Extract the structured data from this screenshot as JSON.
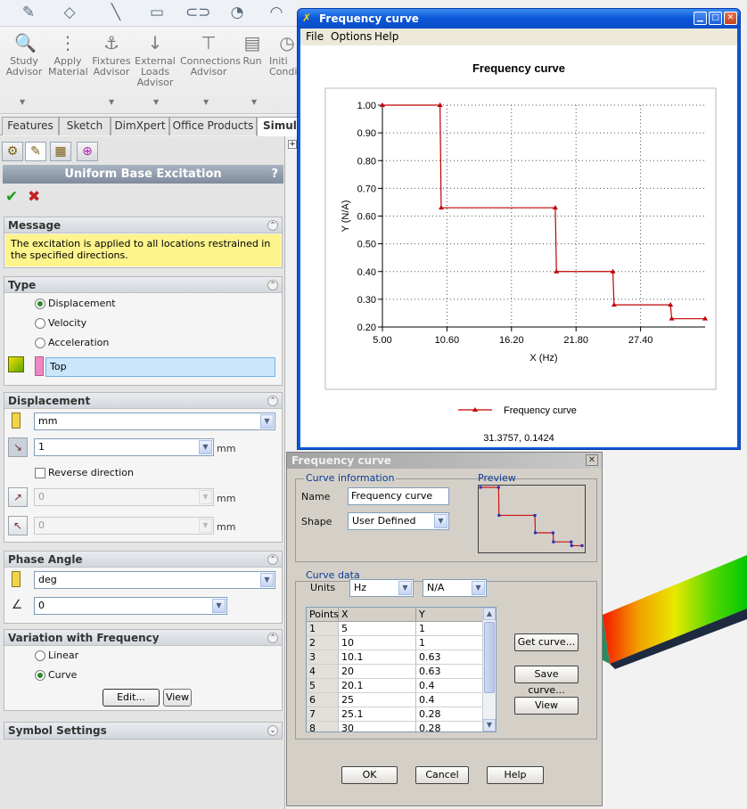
{
  "ribbon": {
    "buttons": [
      {
        "label": "Study\nAdvisor",
        "icon": "study-advisor-icon"
      },
      {
        "label": "Apply\nMaterial",
        "icon": "apply-material-icon"
      },
      {
        "label": "Fixtures\nAdvisor",
        "icon": "fixtures-advisor-icon"
      },
      {
        "label": "External\nLoads\nAdvisor",
        "icon": "external-loads-icon"
      },
      {
        "label": "Connections\nAdvisor",
        "icon": "connections-advisor-icon"
      },
      {
        "label": "Run",
        "icon": "run-icon"
      },
      {
        "label": "Initi\nCondi",
        "icon": "initial-conditions-icon"
      }
    ]
  },
  "tabs": [
    "Features",
    "Sketch",
    "DimXpert",
    "Office Products",
    "Simula"
  ],
  "pm": {
    "title": "Uniform Base Excitation",
    "help": "?",
    "message": {
      "title": "Message",
      "text": "The excitation is applied to all locations restrained in the specified directions."
    },
    "type": {
      "title": "Type",
      "options": [
        "Displacement",
        "Velocity",
        "Acceleration"
      ],
      "selected": "Displacement",
      "direction_reference": "Top"
    },
    "displacement": {
      "title": "Displacement",
      "unit": "mm",
      "value1": "1",
      "value1_unit": "mm",
      "reverse_label": "Reverse direction",
      "value2": "0",
      "value2_unit": "mm",
      "value3": "0",
      "value3_unit": "mm"
    },
    "phase": {
      "title": "Phase Angle",
      "unit": "deg",
      "value": "0"
    },
    "variation": {
      "title": "Variation with Frequency",
      "options": [
        "Linear",
        "Curve"
      ],
      "selected": "Curve",
      "edit_label": "Edit...",
      "view_label": "View"
    },
    "symbol": {
      "title": "Symbol Settings"
    }
  },
  "chart_window": {
    "title": "Frequency curve",
    "menu": [
      "File",
      "Options",
      "Help"
    ],
    "cursor_readout": "31.3757, 0.1424"
  },
  "chart_data": {
    "type": "line",
    "title": "Frequency curve",
    "xlabel": "X (Hz)",
    "ylabel": "Y (N/A)",
    "x_ticks": [
      "5.00",
      "10.60",
      "16.20",
      "21.80",
      "27.40"
    ],
    "y_ticks": [
      "0.20",
      "0.30",
      "0.40",
      "0.50",
      "0.60",
      "0.70",
      "0.80",
      "0.90",
      "1.00"
    ],
    "xlim": [
      5,
      33
    ],
    "ylim": [
      0.2,
      1.0
    ],
    "grid": true,
    "legend": "bottom",
    "series": [
      {
        "name": "Frequency curve",
        "color": "#c00000",
        "x": [
          5,
          10,
          10.1,
          20,
          20.1,
          25,
          25.1,
          30,
          30.1,
          33
        ],
        "y": [
          1,
          1,
          0.63,
          0.63,
          0.4,
          0.4,
          0.28,
          0.28,
          0.23,
          0.23
        ]
      }
    ]
  },
  "curve_dialog": {
    "title": "Frequency curve",
    "info_title": "Curve information",
    "name_label": "Name",
    "name_value": "Frequency curve",
    "shape_label": "Shape",
    "shape_value": "User Defined",
    "preview_title": "Preview",
    "data_title": "Curve data",
    "units_label": "Units",
    "x_unit": "Hz",
    "y_unit": "N/A",
    "columns": [
      "Points",
      "X",
      "Y"
    ],
    "rows": [
      [
        "1",
        "5",
        "1"
      ],
      [
        "2",
        "10",
        "1"
      ],
      [
        "3",
        "10.1",
        "0.63"
      ],
      [
        "4",
        "20",
        "0.63"
      ],
      [
        "5",
        "20.1",
        "0.4"
      ],
      [
        "6",
        "25",
        "0.4"
      ],
      [
        "7",
        "25.1",
        "0.28"
      ],
      [
        "8",
        "30",
        "0.28"
      ]
    ],
    "get_curve_label": "Get curve...",
    "save_curve_label": "Save curve...",
    "view_label": "View",
    "ok_label": "OK",
    "cancel_label": "Cancel",
    "help_label": "Help"
  },
  "colors": {
    "xp_blue": "#0a56d8",
    "message_bg": "#fdf48c",
    "curve_red": "#c00000",
    "accent_green": "#2a8a2a"
  }
}
